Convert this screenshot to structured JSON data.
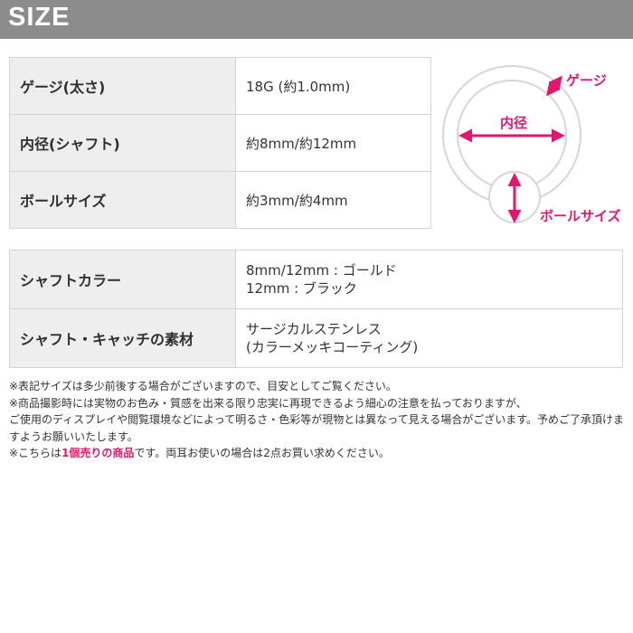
{
  "header": {
    "title": "SIZE"
  },
  "spec_table_1": [
    {
      "label": "ゲージ(太さ)",
      "value": "18G (約1.0mm)"
    },
    {
      "label": "内径(シャフト)",
      "value": "約8mm/約12mm"
    },
    {
      "label": "ボールサイズ",
      "value": "約3mm/約4mm"
    }
  ],
  "spec_table_2": [
    {
      "label": "シャフトカラー",
      "lines": [
        "8mm/12mm : ゴールド",
        "12mm : ブラック"
      ]
    },
    {
      "label": "シャフト・キャッチの素材",
      "lines": [
        "サージカルステンレス",
        "(カラーメッキコーティング)"
      ]
    }
  ],
  "diagram": {
    "gauge_label": "ゲージ",
    "inner_diameter_label": "内径",
    "ball_size_label": "ボールサイズ",
    "accent_color": "#e2166f",
    "ring_color": "#d9d9d9"
  },
  "notes": {
    "line1": "※表記サイズは多少前後する場合がございますので、目安としてご覧ください。",
    "line2a": "※商品撮影時には実物のお色み・質感を出来る限り忠実に再現できるよう細心の注意を払っておりますが、",
    "line2b": "ご使用のディスプレイや閲覧環境などによって明るさ・色彩等が現物とは異なって見える場合がございます。予めご了承頂けますようお願いいたします。",
    "line3_prefix": "※こちらは",
    "line3_highlight": "1個売りの商品",
    "line3_suffix": "です。両耳お使いの場合は2点お買い求めください。"
  }
}
